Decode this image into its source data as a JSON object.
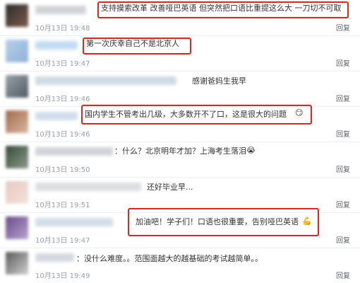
{
  "colors": {
    "highlight": "#e8231a",
    "time": "#9aa0a6",
    "reply": "#5f6368"
  },
  "comments": [
    {
      "text": "支持摸索改革 改善哑巴英语 但突然把口语比重提这么大 一刀切不可取",
      "time": "10月13日 19:48",
      "reply": "回复",
      "emoji": ""
    },
    {
      "text": "第一次庆幸自己不是北京人",
      "time": "10月13日 19:47",
      "reply": "回复",
      "emoji": ""
    },
    {
      "text": "感谢爸妈生我早",
      "time": "10月13日 19:46",
      "reply": "回复",
      "emoji": ""
    },
    {
      "text": "国内学生不管考出几级，大多数开不了口，这是很大的问题",
      "time": "10月13日 19:46",
      "reply": "回复",
      "emoji": "😏"
    },
    {
      "text": "：什么？北京明年才加？上海考生落泪",
      "time": "10月13日 19:50",
      "reply": "回复",
      "emoji": "😭"
    },
    {
      "text": "还好毕业早...",
      "time": "10月13日 19:51",
      "reply": "回复",
      "emoji": ""
    },
    {
      "text": "加油吧！学子们！口语也很重要，告别哑巴英语",
      "time": "10月13日 19:47",
      "reply": "回复",
      "emoji": "💪"
    },
    {
      "text": "：没什么难度。。范围面越大的越基础的考试越简单。。",
      "time": "10月13日 19:49",
      "reply": "回复",
      "emoji": ""
    }
  ]
}
